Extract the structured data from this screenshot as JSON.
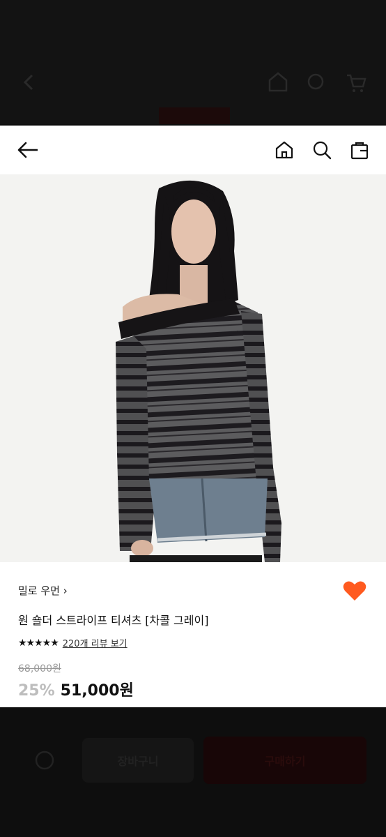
{
  "background_header": {
    "icons": [
      "chevron-left-icon",
      "home-icon",
      "search-icon",
      "cart-icon"
    ]
  },
  "topbar": {
    "icons": [
      "back-arrow-icon",
      "home-icon",
      "search-icon",
      "shopping-bag-icon"
    ]
  },
  "product": {
    "brand": "밀로 우먼",
    "brand_chevron": "›",
    "name": "원 숄더 스트라이프 티셔츠 [차콜 그레이]",
    "stars": "★★★★★",
    "review_link": "220개 리뷰 보기",
    "original_price": "68,000원",
    "discount": "25%",
    "price": "51,000원",
    "liked": true
  },
  "background_bottom": {
    "cart_button": "장바구니",
    "buy_button": "구매하기"
  },
  "colors": {
    "heart": "#ff5a1f",
    "discount_text": "#bdbdbd",
    "overlay": "#0c0c0c"
  }
}
